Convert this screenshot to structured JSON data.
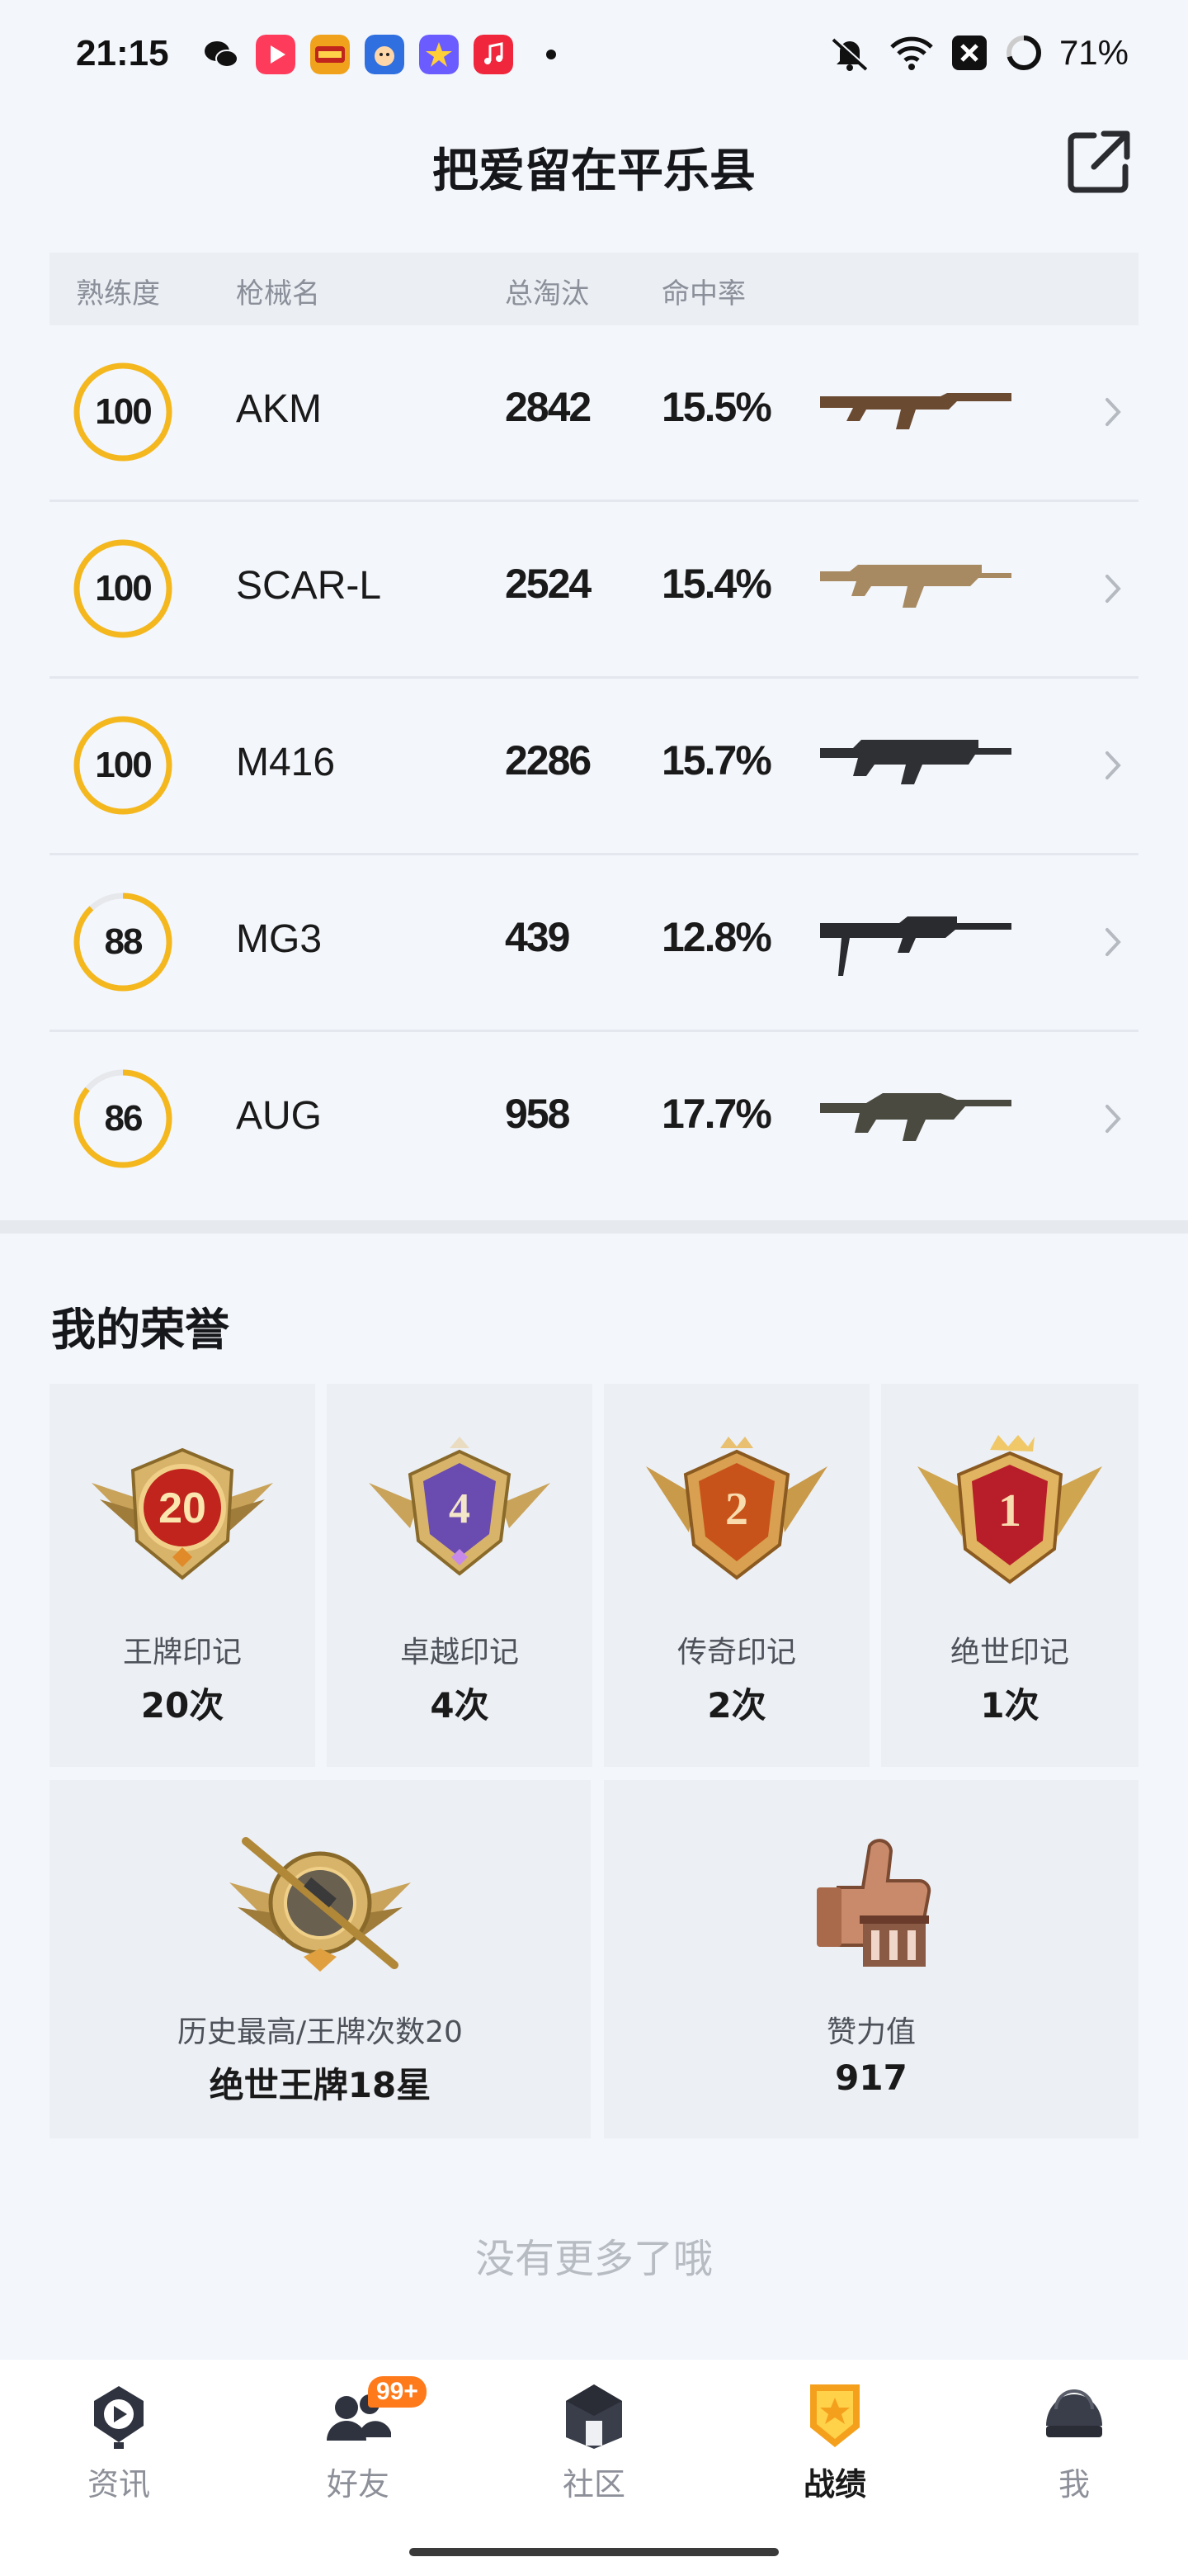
{
  "status_bar": {
    "time": "21:15",
    "battery": "71%",
    "icons": [
      "wechat-icon",
      "video-app-icon",
      "game-app-icon",
      "game2-app-icon",
      "star-app-icon",
      "music-app-icon",
      "mute-icon",
      "wifi-icon",
      "close-box-icon",
      "battery-ring-icon"
    ]
  },
  "header": {
    "title": "把爱留在平乐县",
    "share_icon": "share-export-icon"
  },
  "table": {
    "headers": [
      "熟练度",
      "枪械名",
      "总淘汰",
      "命中率"
    ],
    "rows": [
      {
        "proficiency": "100",
        "level": 1.0,
        "name": "AKM",
        "kills": "2842",
        "hit_rate": "15.5%",
        "gun_color": "#6b4a32"
      },
      {
        "proficiency": "100",
        "level": 1.0,
        "name": "SCAR-L",
        "kills": "2524",
        "hit_rate": "15.4%",
        "gun_color": "#a88a62"
      },
      {
        "proficiency": "100",
        "level": 1.0,
        "name": "M416",
        "kills": "2286",
        "hit_rate": "15.7%",
        "gun_color": "#2f3033"
      },
      {
        "proficiency": "88",
        "level": 0.88,
        "name": "MG3",
        "kills": "439",
        "hit_rate": "12.8%",
        "gun_color": "#2a2b2e"
      },
      {
        "proficiency": "86",
        "level": 0.86,
        "name": "AUG",
        "kills": "958",
        "hit_rate": "17.7%",
        "gun_color": "#4a4a40"
      }
    ]
  },
  "honors": {
    "title": "我的荣誉",
    "marks": [
      {
        "badge_text": "20",
        "label": "王牌印记",
        "value": "20次",
        "color": "#c0241c"
      },
      {
        "badge_text": "4",
        "label": "卓越印记",
        "value": "4次",
        "color": "#6a4bb0"
      },
      {
        "badge_text": "2",
        "label": "传奇印记",
        "value": "2次",
        "color": "#c8531a"
      },
      {
        "badge_text": "1",
        "label": "绝世印记",
        "value": "1次",
        "color": "#b81e2a"
      }
    ],
    "best": {
      "label": "历史最高/王牌次数20",
      "value": "绝世王牌18星"
    },
    "likes": {
      "label": "赞力值",
      "value": "917"
    }
  },
  "footer_text": "没有更多了哦",
  "nav": {
    "items": [
      {
        "label": "资讯",
        "icon": "news-icon"
      },
      {
        "label": "好友",
        "icon": "friends-icon",
        "badge": "99+"
      },
      {
        "label": "社区",
        "icon": "community-icon"
      },
      {
        "label": "战绩",
        "icon": "record-icon",
        "active": true
      },
      {
        "label": "我",
        "icon": "helmet-icon"
      }
    ]
  },
  "colors": {
    "ring": "#f4b81e",
    "accent_orange": "#f5a01c",
    "badge_orange": "#ff7a1a"
  }
}
